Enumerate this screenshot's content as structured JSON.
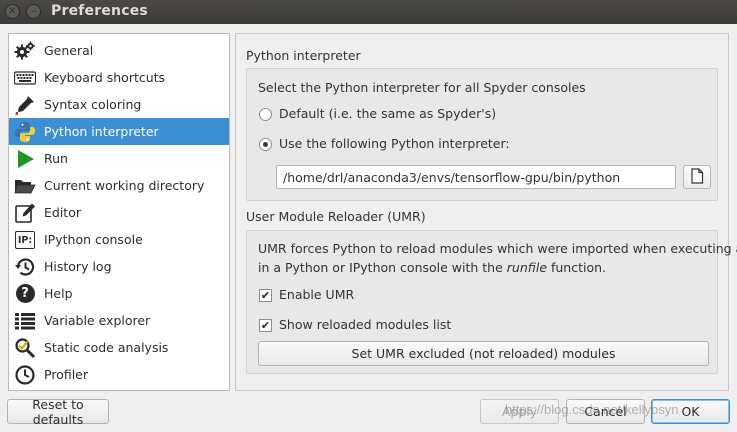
{
  "window": {
    "title": "Preferences",
    "close_glyph": "✕",
    "minimize_glyph": "–"
  },
  "sidebar": {
    "items": [
      {
        "label": "General",
        "icon": "gears-icon"
      },
      {
        "label": "Keyboard shortcuts",
        "icon": "keyboard-icon"
      },
      {
        "label": "Syntax coloring",
        "icon": "eyedropper-icon"
      },
      {
        "label": "Python interpreter",
        "icon": "python-icon",
        "selected": true
      },
      {
        "label": "Run",
        "icon": "play-icon"
      },
      {
        "label": "Current working directory",
        "icon": "folder-open-icon"
      },
      {
        "label": "Editor",
        "icon": "edit-icon"
      },
      {
        "label": "IPython console",
        "icon": "ipython-icon",
        "icon_text": "IP:"
      },
      {
        "label": "History log",
        "icon": "history-icon"
      },
      {
        "label": "Help",
        "icon": "help-icon",
        "icon_text": "?"
      },
      {
        "label": "Variable explorer",
        "icon": "table-icon"
      },
      {
        "label": "Static code analysis",
        "icon": "magnifier-check-icon"
      },
      {
        "label": "Profiler",
        "icon": "clock-icon"
      }
    ]
  },
  "interpreter": {
    "section_title": "Python interpreter",
    "description": "Select the Python interpreter for all Spyder consoles",
    "option_default": "Default (i.e. the same as Spyder's)",
    "option_custom": "Use the following Python interpreter:",
    "selected_option": "custom",
    "path_value": "/home/drl/anaconda3/envs/tensorflow-gpu/bin/python"
  },
  "umr": {
    "section_title": "User Module Reloader (UMR)",
    "description_line1": "UMR forces Python to reload modules which were imported when executing a file",
    "description_line2_prefix": "in a Python or IPython console with the ",
    "description_line2_em": "runfile",
    "description_line2_suffix": " function.",
    "enable_label": "Enable UMR",
    "enable_checked": true,
    "show_label": "Show reloaded modules list",
    "show_checked": true,
    "excluded_button": "Set UMR excluded (not reloaded) modules",
    "check_glyph": "✔"
  },
  "footer": {
    "reset_button": "Reset to defaults",
    "apply_button": "Apply",
    "cancel_button": "Cancel",
    "ok_button": "OK"
  },
  "watermark": "https://blog.csdn.net/kellyosyn",
  "colors": {
    "selection": "#3d8fd3",
    "titlebar": "#3b3a37",
    "run_green": "#1a9a24"
  }
}
